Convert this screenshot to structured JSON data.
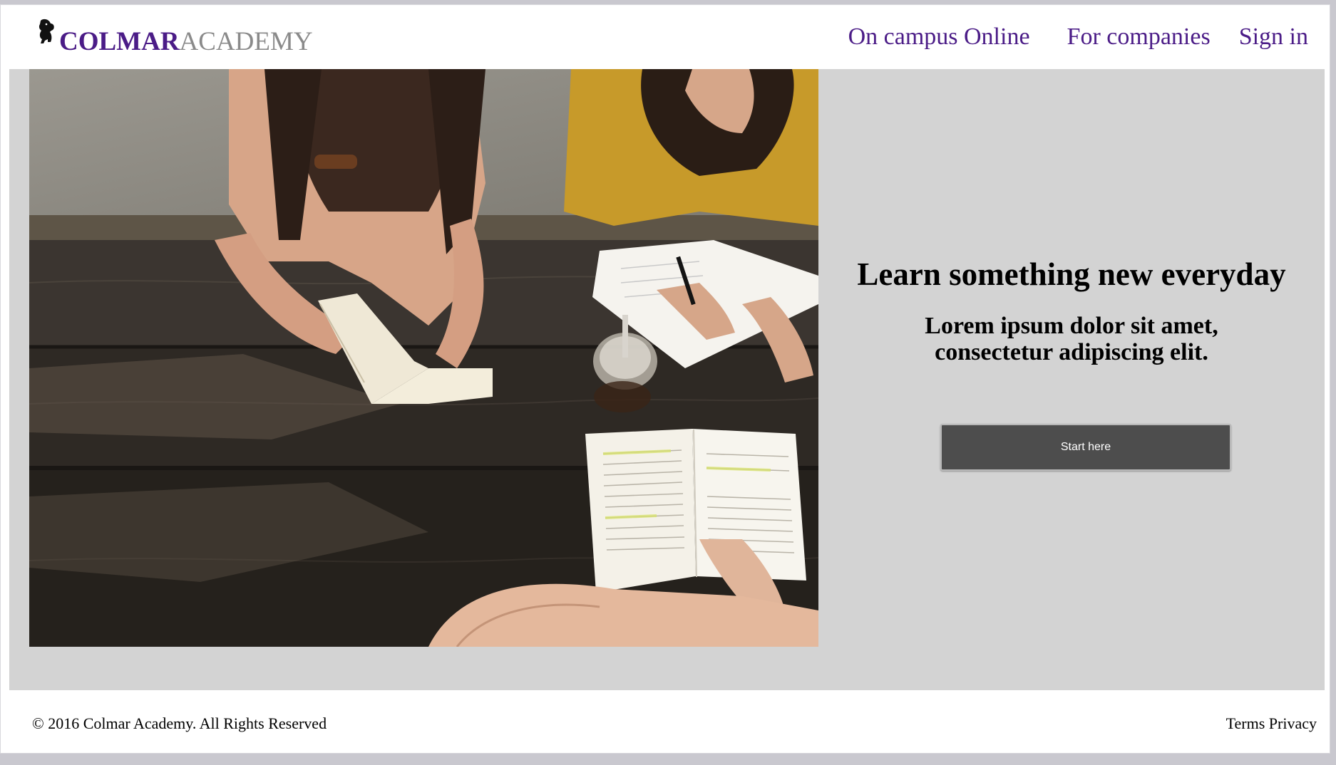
{
  "header": {
    "logo_strong": "COLMAR",
    "logo_light": "ACADEMY",
    "nav": [
      {
        "label": "On campus Online"
      },
      {
        "label": "For companies"
      },
      {
        "label": "Sign in"
      }
    ]
  },
  "hero": {
    "title": "Learn something new everyday",
    "subtitle": "Lorem ipsum dolor sit amet, consectetur adipiscing elit.",
    "cta_label": "Start here"
  },
  "footer": {
    "copyright": "© 2016 Colmar Academy. All Rights Reserved",
    "links": [
      {
        "label": "Terms"
      },
      {
        "label": "Privacy"
      }
    ]
  },
  "colors": {
    "brand": "#4b1c87",
    "hero_bg": "#d3d3d3",
    "button": "#4d4d4d"
  }
}
